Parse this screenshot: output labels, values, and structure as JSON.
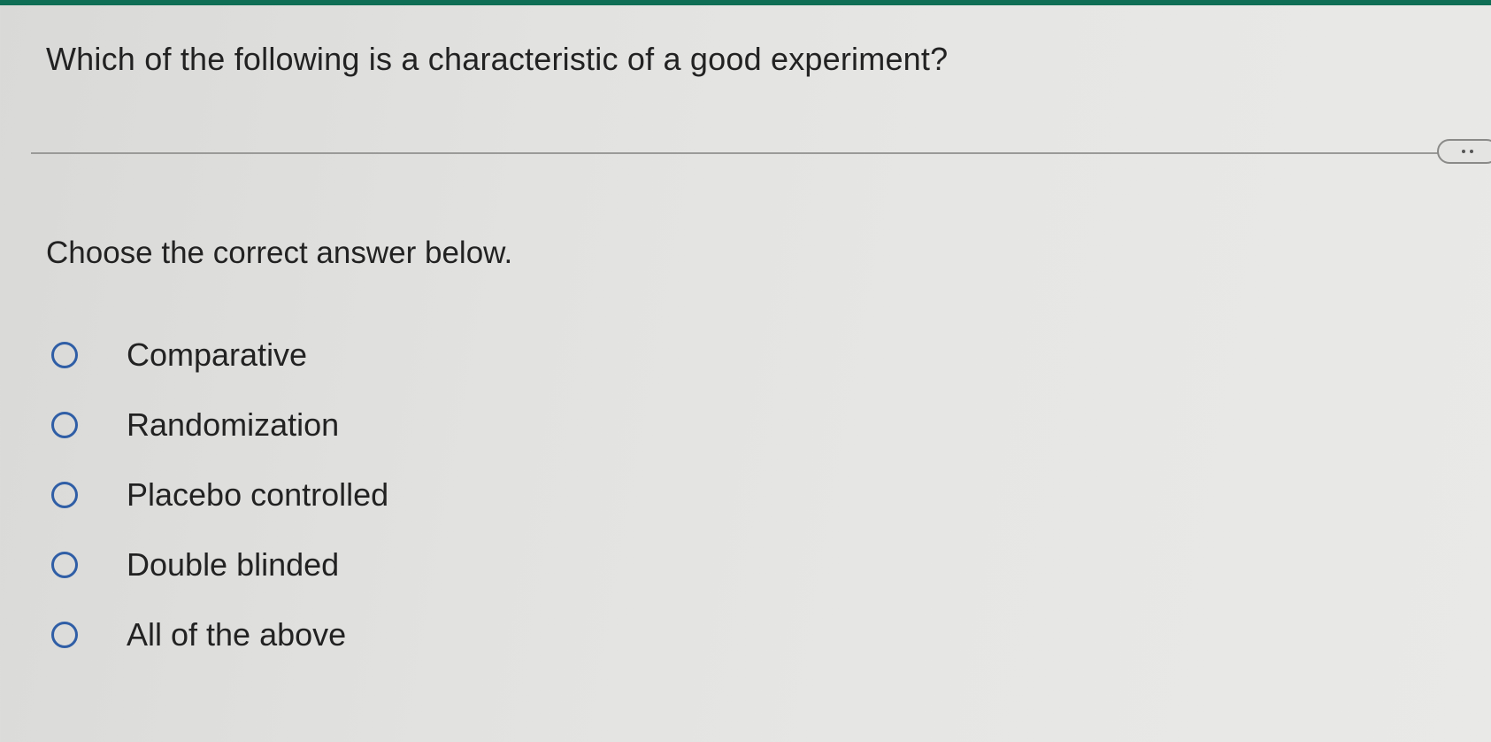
{
  "question": {
    "text": "Which of the following is a characteristic of a good experiment?"
  },
  "more_button": {
    "icon": "ellipsis-icon"
  },
  "instruction": "Choose the correct answer below.",
  "options": [
    {
      "label": "Comparative",
      "selected": false
    },
    {
      "label": "Randomization",
      "selected": false
    },
    {
      "label": "Placebo controlled",
      "selected": false
    },
    {
      "label": "Double blinded",
      "selected": false
    },
    {
      "label": "All of the above",
      "selected": false
    }
  ],
  "colors": {
    "top_bar": "#0f6e55",
    "radio_border": "#2f5ea6",
    "text": "#222222"
  }
}
